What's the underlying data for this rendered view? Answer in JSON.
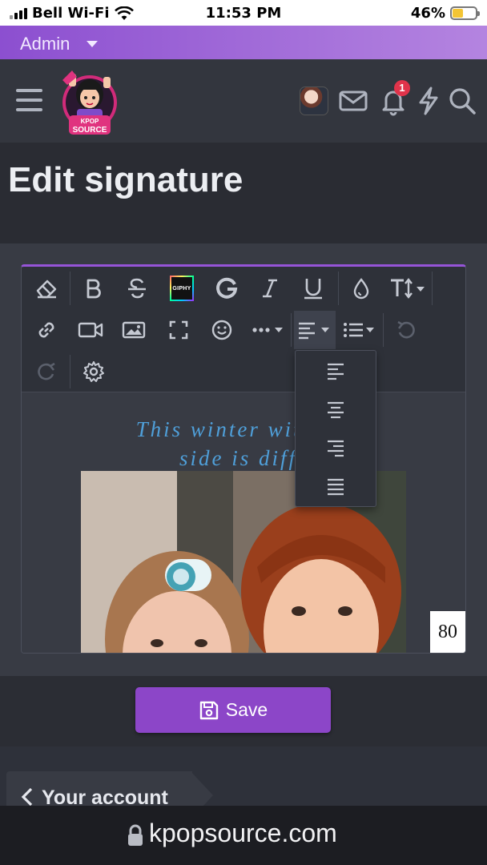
{
  "status_bar": {
    "carrier": "Bell Wi-Fi",
    "time": "11:53 PM",
    "battery": "46%"
  },
  "admin": {
    "label": "Admin"
  },
  "header": {
    "logo_line1": "KPOP",
    "logo_line2": "SOURCE",
    "notification_count": "1"
  },
  "page": {
    "title": "Edit signature"
  },
  "toolbar": {
    "giphy_label": "GIPHY"
  },
  "editor": {
    "signature_line1": "This winter with          my",
    "signature_line2": "side is diffe",
    "number_box": "80"
  },
  "save": {
    "label": "Save"
  },
  "breadcrumb": {
    "label": "Your account"
  },
  "url": {
    "domain": "kpopsource.com"
  }
}
